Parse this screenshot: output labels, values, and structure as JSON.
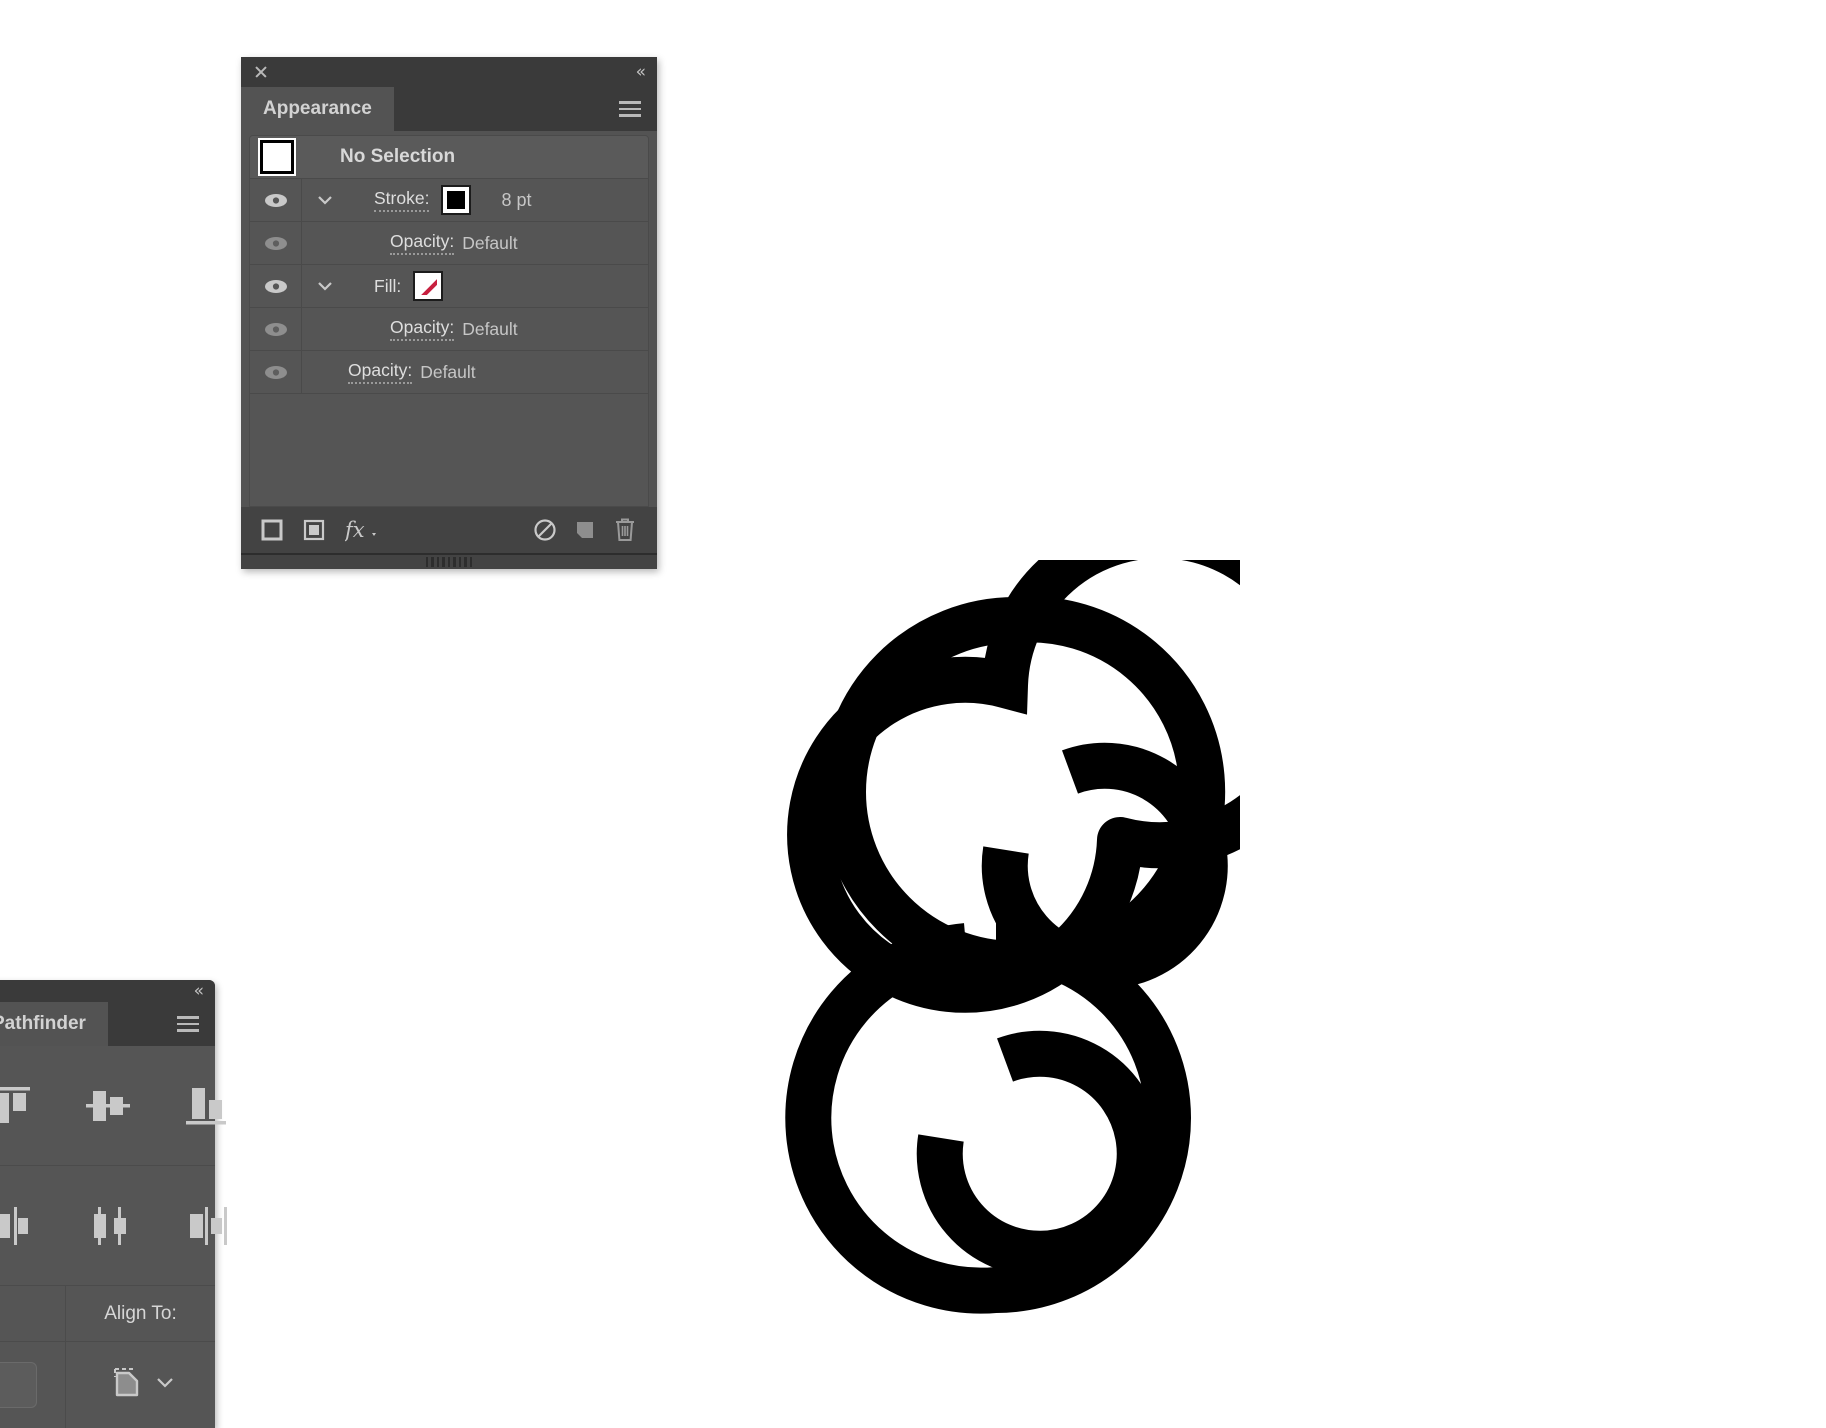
{
  "app": {
    "background_color": "#ffffff",
    "panel_bg": "#535353",
    "panel_chrome": "#3a3a3a",
    "accent_red": "#c8203f"
  },
  "appearance_panel": {
    "title": "Appearance",
    "close_icon": "close-icon",
    "collapse_icon": "collapse-chevrons-icon",
    "menu_icon": "panel-menu-icon",
    "header_row": {
      "thumb_icon": "no-selection-thumbnail-icon",
      "label": "No Selection"
    },
    "rows": [
      {
        "name": "stroke",
        "eye_icon": "visibility-eye-icon",
        "eye_visible": true,
        "disclosure_icon": "chevron-down-icon",
        "label": "Stroke:",
        "swatch": "black",
        "value": "8 pt"
      },
      {
        "name": "stroke-opacity",
        "eye_icon": "visibility-eye-icon",
        "eye_visible": false,
        "label": "Opacity:",
        "value": "Default"
      },
      {
        "name": "fill",
        "eye_icon": "visibility-eye-icon",
        "eye_visible": true,
        "disclosure_icon": "chevron-down-icon",
        "label": "Fill:",
        "swatch": "none",
        "value": ""
      },
      {
        "name": "fill-opacity",
        "eye_icon": "visibility-eye-icon",
        "eye_visible": false,
        "label": "Opacity:",
        "value": "Default"
      },
      {
        "name": "object-opacity",
        "eye_icon": "visibility-eye-icon",
        "eye_visible": false,
        "label": "Opacity:",
        "value": "Default"
      }
    ],
    "footer": {
      "add_stroke": "add-new-stroke-button",
      "add_fill": "add-new-fill-button",
      "fx": "fx",
      "clear": "clear-appearance-button",
      "duplicate": "duplicate-item-button",
      "delete": "delete-item-button"
    }
  },
  "pathfinder_panel": {
    "title": "Pathfinder",
    "collapse_icon": "collapse-chevrons-icon",
    "menu_icon": "panel-menu-icon",
    "vertical_align": [
      {
        "name": "vertical-align-top",
        "icon": "align-top-icon"
      },
      {
        "name": "vertical-align-center",
        "icon": "align-vertical-center-icon"
      },
      {
        "name": "vertical-align-bottom",
        "icon": "align-bottom-icon"
      }
    ],
    "horizontal_align": [
      {
        "name": "horizontal-align-left",
        "icon": "align-left-icon"
      },
      {
        "name": "horizontal-align-center",
        "icon": "align-horizontal-center-icon"
      },
      {
        "name": "horizontal-align-right",
        "icon": "align-right-icon"
      }
    ],
    "align_to_label": "Align To:",
    "align_to_icon": "align-to-artboard-icon",
    "align_to_chevron": "chevron-down-icon"
  },
  "artwork": {
    "name": "figure-eight-spiral-artwork",
    "stroke_color": "#000000",
    "fill_color": "none",
    "stroke_width_pt": "8 pt"
  }
}
